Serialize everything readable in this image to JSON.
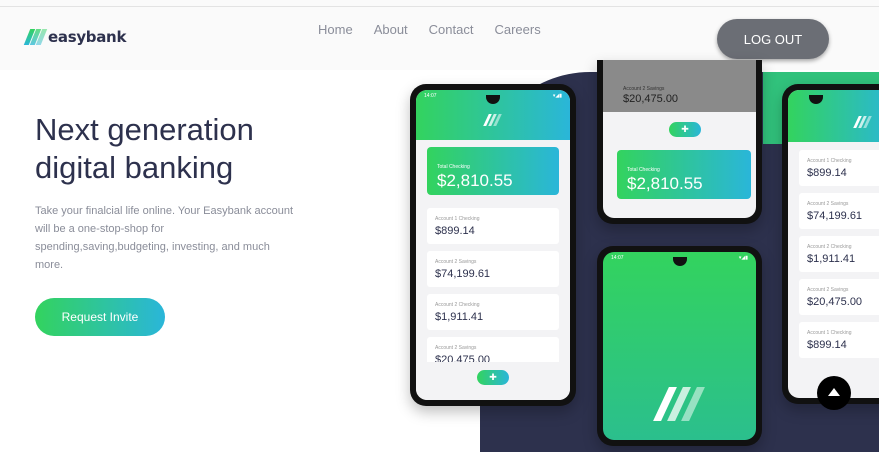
{
  "header": {
    "logo_text": "easybank",
    "nav": [
      "Home",
      "About",
      "Contact",
      "Careers"
    ],
    "logout_label": "LOG OUT"
  },
  "hero": {
    "title_line1": "Next generation",
    "title_line2": "digital banking",
    "description_lines": [
      "Take your finalcial life online. Your Easybank account",
      "will be a one-stop-shop for",
      "spending,saving,budgeting, investing, and much",
      "more."
    ],
    "cta_label": "Request Invite"
  },
  "phones": {
    "status_time": "14:07",
    "status_icons": "▾◢▮",
    "left": {
      "total_label": "Total Checking",
      "total_amount": "$2,810.55",
      "accounts": [
        {
          "label": "Account 1 Checking",
          "amount": "$899.14"
        },
        {
          "label": "Account 2 Savings",
          "amount": "$74,199.61"
        },
        {
          "label": "Account 2 Checking",
          "amount": "$1,911.41"
        },
        {
          "label": "Account 2 Savings",
          "amount": "$20,475.00"
        }
      ]
    },
    "top_middle": {
      "account_label": "Account 2 Savings",
      "account_amount": "$20,475.00",
      "total_label": "Total Checking",
      "total_amount": "$2,810.55"
    },
    "right": {
      "accounts": [
        {
          "label": "Account 1 Checking",
          "amount": "$899.14"
        },
        {
          "label": "Account 2 Savings",
          "amount": "$74,199.61"
        },
        {
          "label": "Account 2 Checking",
          "amount": "$1,911.41"
        },
        {
          "label": "Account 2 Savings",
          "amount": "$20,475.00"
        },
        {
          "label": "Account 1 Checking",
          "amount": "$899.14"
        }
      ]
    }
  },
  "colors": {
    "brand_green": "#33d35e",
    "brand_cyan": "#2ab6d9",
    "dark_blue": "#2d314d",
    "logout_gray": "#6b6e75"
  }
}
